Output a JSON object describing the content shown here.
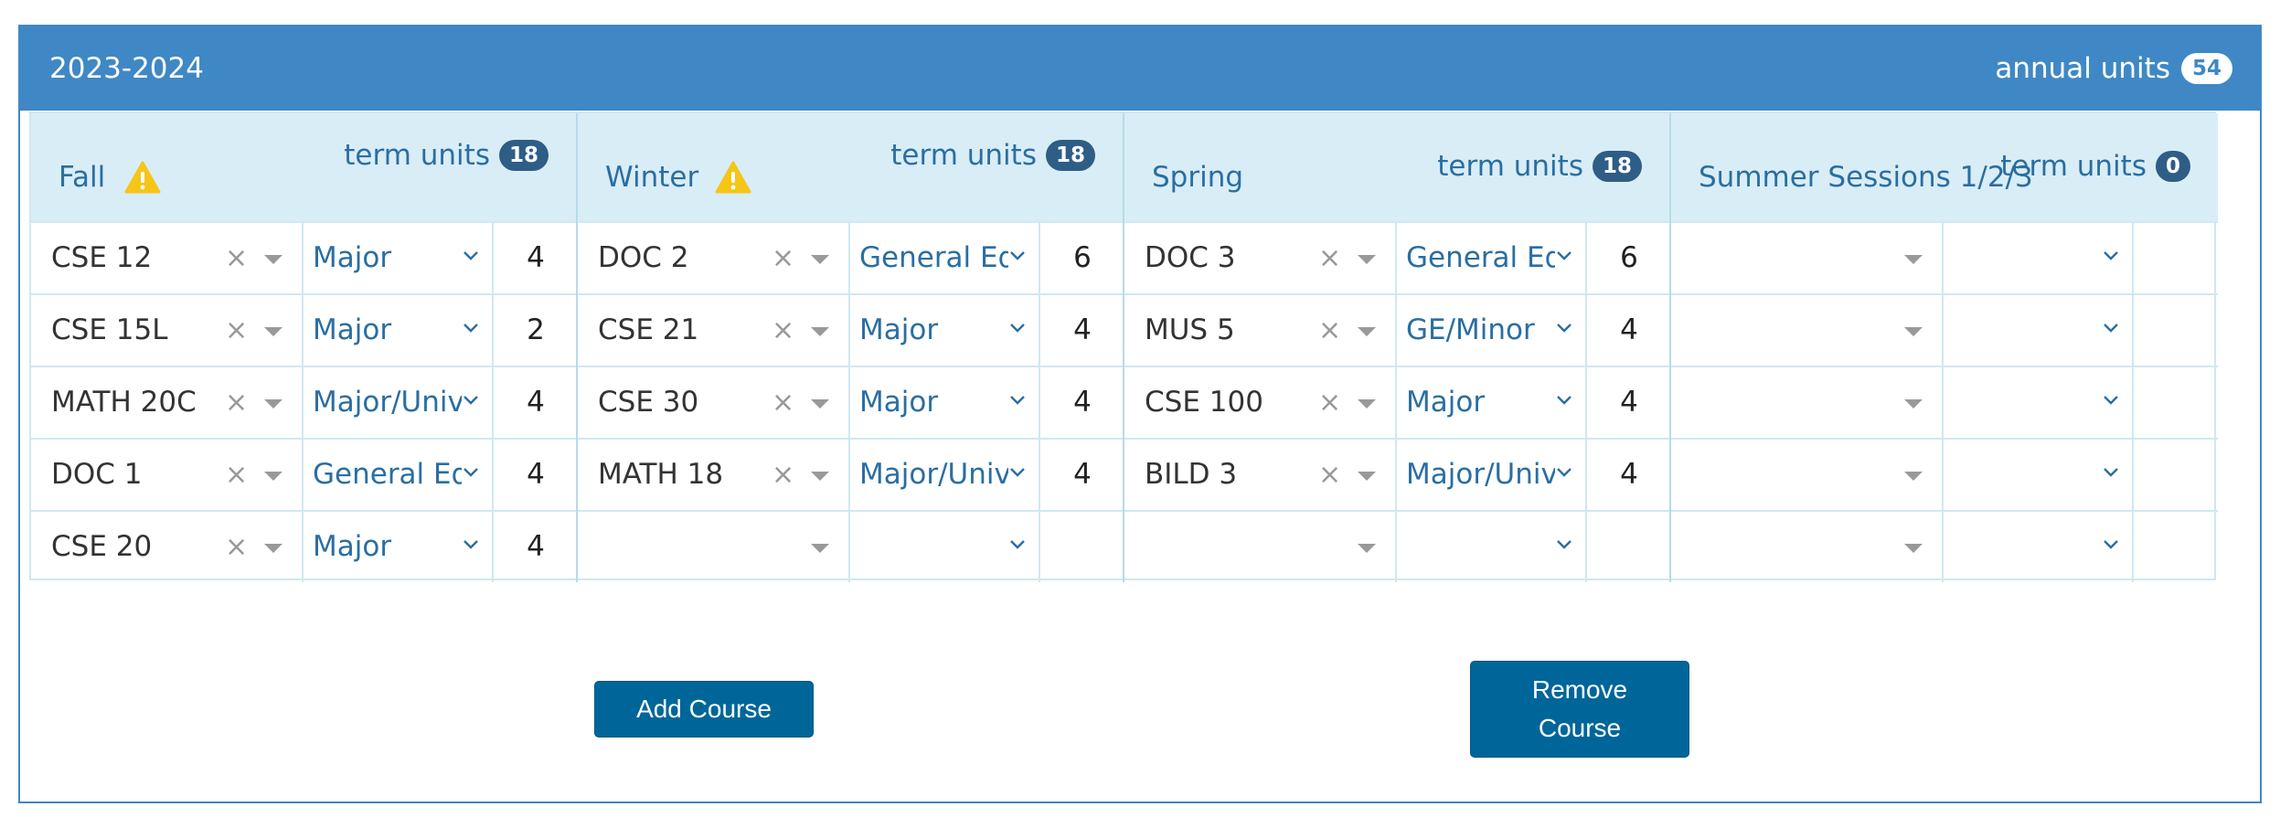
{
  "year_card": {
    "title": "2023-2024",
    "annual_units_label": "annual units",
    "annual_units_value": "54"
  },
  "icons": {
    "warning": "warning-triangle-icon",
    "clear": "clear-x-icon",
    "caret": "caret-down-icon",
    "chevron": "chevron-down-icon"
  },
  "colors": {
    "header": "#3f88c5",
    "term_header": "#d9edf6",
    "button": "#006699",
    "warning": "#f5c518",
    "badge": "#2e5d86"
  },
  "terms": [
    {
      "name": "Fall",
      "warning": true,
      "units_label": "term units",
      "units_value": "18",
      "rows": [
        {
          "course": "CSE 12",
          "category": "Major",
          "units": "4"
        },
        {
          "course": "CSE 15L",
          "category": "Major",
          "units": "2"
        },
        {
          "course": "MATH 20C",
          "category": "Major/University",
          "units": "4"
        },
        {
          "course": "DOC 1",
          "category": "General Education",
          "units": "4"
        },
        {
          "course": "CSE 20",
          "category": "Major",
          "units": "4"
        }
      ]
    },
    {
      "name": "Winter",
      "warning": true,
      "units_label": "term units",
      "units_value": "18",
      "rows": [
        {
          "course": "DOC 2",
          "category": "General Education",
          "units": "6"
        },
        {
          "course": "CSE 21",
          "category": "Major",
          "units": "4"
        },
        {
          "course": "CSE 30",
          "category": "Major",
          "units": "4"
        },
        {
          "course": "MATH 18",
          "category": "Major/University",
          "units": "4"
        },
        {
          "course": "",
          "category": "",
          "units": ""
        }
      ]
    },
    {
      "name": "Spring",
      "warning": false,
      "units_label": "term units",
      "units_value": "18",
      "rows": [
        {
          "course": "DOC 3",
          "category": "General Education",
          "units": "6"
        },
        {
          "course": "MUS 5",
          "category": "GE/Minor",
          "units": "4"
        },
        {
          "course": "CSE 100",
          "category": "Major",
          "units": "4"
        },
        {
          "course": "BILD 3",
          "category": "Major/University",
          "units": "4"
        },
        {
          "course": "",
          "category": "",
          "units": ""
        }
      ]
    },
    {
      "name": "Summer Sessions 1/2/3",
      "warning": false,
      "units_label": "term units",
      "units_value": "0",
      "rows": [
        {
          "course": "",
          "category": "",
          "units": ""
        },
        {
          "course": "",
          "category": "",
          "units": ""
        },
        {
          "course": "",
          "category": "",
          "units": ""
        },
        {
          "course": "",
          "category": "",
          "units": ""
        },
        {
          "course": "",
          "category": "",
          "units": ""
        }
      ]
    }
  ],
  "buttons": {
    "add_course": "Add Course",
    "remove_course": "Remove Course"
  }
}
